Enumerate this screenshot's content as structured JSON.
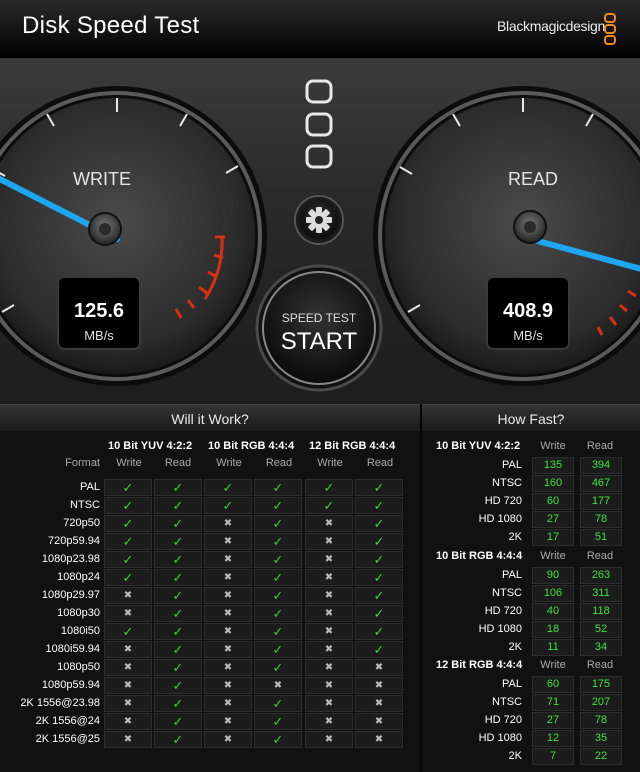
{
  "window": {
    "title": "Disk Speed Test",
    "brand": "Blackmagicdesign"
  },
  "gauges": {
    "write": {
      "label": "WRITE",
      "value": "125.6",
      "unit": "MB/s"
    },
    "read": {
      "label": "READ",
      "value": "408.9",
      "unit": "MB/s"
    }
  },
  "start_button": {
    "line1": "SPEED TEST",
    "line2": "START"
  },
  "icons": [
    "settings-gear-icon",
    "target-drive-selector-icon",
    "close-icon"
  ],
  "will_it_work": {
    "title": "Will it Work?",
    "format_label": "Format",
    "groups": [
      "10 Bit YUV 4:2:2",
      "10 Bit RGB 4:4:4",
      "12 Bit RGB 4:4:4"
    ],
    "sub_write": "Write",
    "sub_read": "Read",
    "rows": [
      {
        "format": "PAL",
        "cells": [
          "ok",
          "ok",
          "ok",
          "ok",
          "ok",
          "ok"
        ]
      },
      {
        "format": "NTSC",
        "cells": [
          "ok",
          "ok",
          "ok",
          "ok",
          "ok",
          "ok"
        ]
      },
      {
        "format": "720p50",
        "cells": [
          "ok",
          "ok",
          "no",
          "ok",
          "no",
          "ok"
        ]
      },
      {
        "format": "720p59.94",
        "cells": [
          "ok",
          "ok",
          "no",
          "ok",
          "no",
          "ok"
        ]
      },
      {
        "format": "1080p23.98",
        "cells": [
          "ok",
          "ok",
          "no",
          "ok",
          "no",
          "ok"
        ]
      },
      {
        "format": "1080p24",
        "cells": [
          "ok",
          "ok",
          "no",
          "ok",
          "no",
          "ok"
        ]
      },
      {
        "format": "1080p29.97",
        "cells": [
          "no",
          "ok",
          "no",
          "ok",
          "no",
          "ok"
        ]
      },
      {
        "format": "1080p30",
        "cells": [
          "no",
          "ok",
          "no",
          "ok",
          "no",
          "ok"
        ]
      },
      {
        "format": "1080i50",
        "cells": [
          "ok",
          "ok",
          "no",
          "ok",
          "no",
          "ok"
        ]
      },
      {
        "format": "1080i59.94",
        "cells": [
          "no",
          "ok",
          "no",
          "ok",
          "no",
          "ok"
        ]
      },
      {
        "format": "1080p50",
        "cells": [
          "no",
          "ok",
          "no",
          "ok",
          "no",
          "no"
        ]
      },
      {
        "format": "1080p59.94",
        "cells": [
          "no",
          "ok",
          "no",
          "no",
          "no",
          "no"
        ]
      },
      {
        "format": "2K 1556@23.98",
        "cells": [
          "no",
          "ok",
          "no",
          "ok",
          "no",
          "no"
        ]
      },
      {
        "format": "2K 1556@24",
        "cells": [
          "no",
          "ok",
          "no",
          "ok",
          "no",
          "no"
        ]
      },
      {
        "format": "2K 1556@25",
        "cells": [
          "no",
          "ok",
          "no",
          "ok",
          "no",
          "no"
        ]
      }
    ]
  },
  "how_fast": {
    "title": "How Fast?",
    "sub_write": "Write",
    "sub_read": "Read",
    "sections": [
      {
        "group": "10 Bit YUV 4:2:2",
        "rows": [
          {
            "label": "PAL",
            "write": "135",
            "read": "394"
          },
          {
            "label": "NTSC",
            "write": "160",
            "read": "467"
          },
          {
            "label": "HD 720",
            "write": "60",
            "read": "177"
          },
          {
            "label": "HD 1080",
            "write": "27",
            "read": "78"
          },
          {
            "label": "2K",
            "write": "17",
            "read": "51"
          }
        ]
      },
      {
        "group": "10 Bit RGB 4:4:4",
        "rows": [
          {
            "label": "PAL",
            "write": "90",
            "read": "263"
          },
          {
            "label": "NTSC",
            "write": "106",
            "read": "311"
          },
          {
            "label": "HD 720",
            "write": "40",
            "read": "118"
          },
          {
            "label": "HD 1080",
            "write": "18",
            "read": "52"
          },
          {
            "label": "2K",
            "write": "11",
            "read": "34"
          }
        ]
      },
      {
        "group": "12 Bit RGB 4:4:4",
        "rows": [
          {
            "label": "PAL",
            "write": "60",
            "read": "175"
          },
          {
            "label": "NTSC",
            "write": "71",
            "read": "207"
          },
          {
            "label": "HD 720",
            "write": "27",
            "read": "78"
          },
          {
            "label": "HD 1080",
            "write": "12",
            "read": "35"
          },
          {
            "label": "2K",
            "write": "7",
            "read": "22"
          }
        ]
      }
    ]
  },
  "colors": {
    "needle": "#1ea7f0",
    "ok_green": "#36d23a",
    "value_green": "#3ee23f",
    "redline": "#e03010"
  }
}
